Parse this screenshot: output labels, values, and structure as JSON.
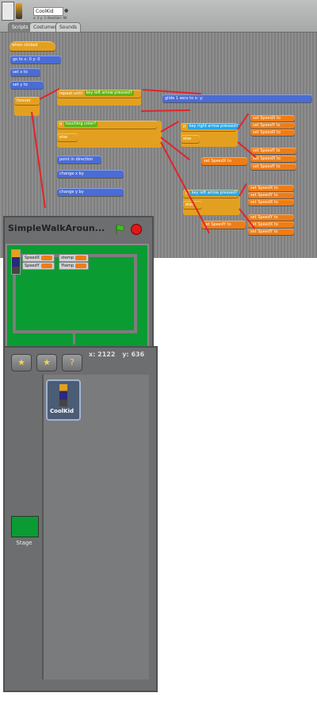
{
  "sprite_header": {
    "name": "CoolKid",
    "info": "x: 2  y: 2  direction: 90"
  },
  "tabs": [
    {
      "label": "Scripts"
    },
    {
      "label": "Costumes"
    },
    {
      "label": "Sounds"
    }
  ],
  "scripts": {
    "when_flag": "when clicked",
    "go_to": "go to x: 0 y: 0",
    "set_x": "set x to",
    "set_y": "set y to",
    "forever": "forever",
    "repeat_until": "repeat until",
    "if1": "if",
    "else1": "else",
    "if2": "if",
    "else2": "else",
    "if3": "if",
    "else3": "else",
    "point": "point in direction",
    "change_x": "change x by",
    "change_y": "change y by",
    "speed_x_label": "SpeedX",
    "speed_y_label": "SpeedY",
    "set_var1": "set SpeedX to",
    "set_var2": "set SpeedY to",
    "glide": "glide 1 secs to x: y:",
    "key_left": "key left arrow pressed?",
    "key_right": "key right arrow pressed?",
    "touching": "touching color?"
  },
  "stage": {
    "title": "SimpleWalkAroun...",
    "watchers": [
      {
        "label": "SpeedX",
        "value": ""
      },
      {
        "label": "SpeedY",
        "value": ""
      },
      {
        "label": "xtemp",
        "value": ""
      },
      {
        "label": "Ytemp",
        "value": ""
      }
    ],
    "x_label": "x:",
    "x_value": "2122",
    "y_label": "y:",
    "y_value": "636"
  },
  "sprites": [
    {
      "name": "CoolKid"
    }
  ],
  "stage_item": {
    "label": "Stage"
  },
  "colors": {
    "control": "#e3a020",
    "motion": "#4a6cd4",
    "variables": "#ee7d16",
    "operators": "#5cb712",
    "stage_green": "#0a9c32",
    "annotation_red": "#e0242c"
  },
  "icons": {
    "green_flag": "green-flag-icon",
    "stop": "stop-icon",
    "paint_new_sprite": "paint-star-icon",
    "choose_sprite_file": "folder-star-icon",
    "random_sprite": "question-star-icon"
  }
}
